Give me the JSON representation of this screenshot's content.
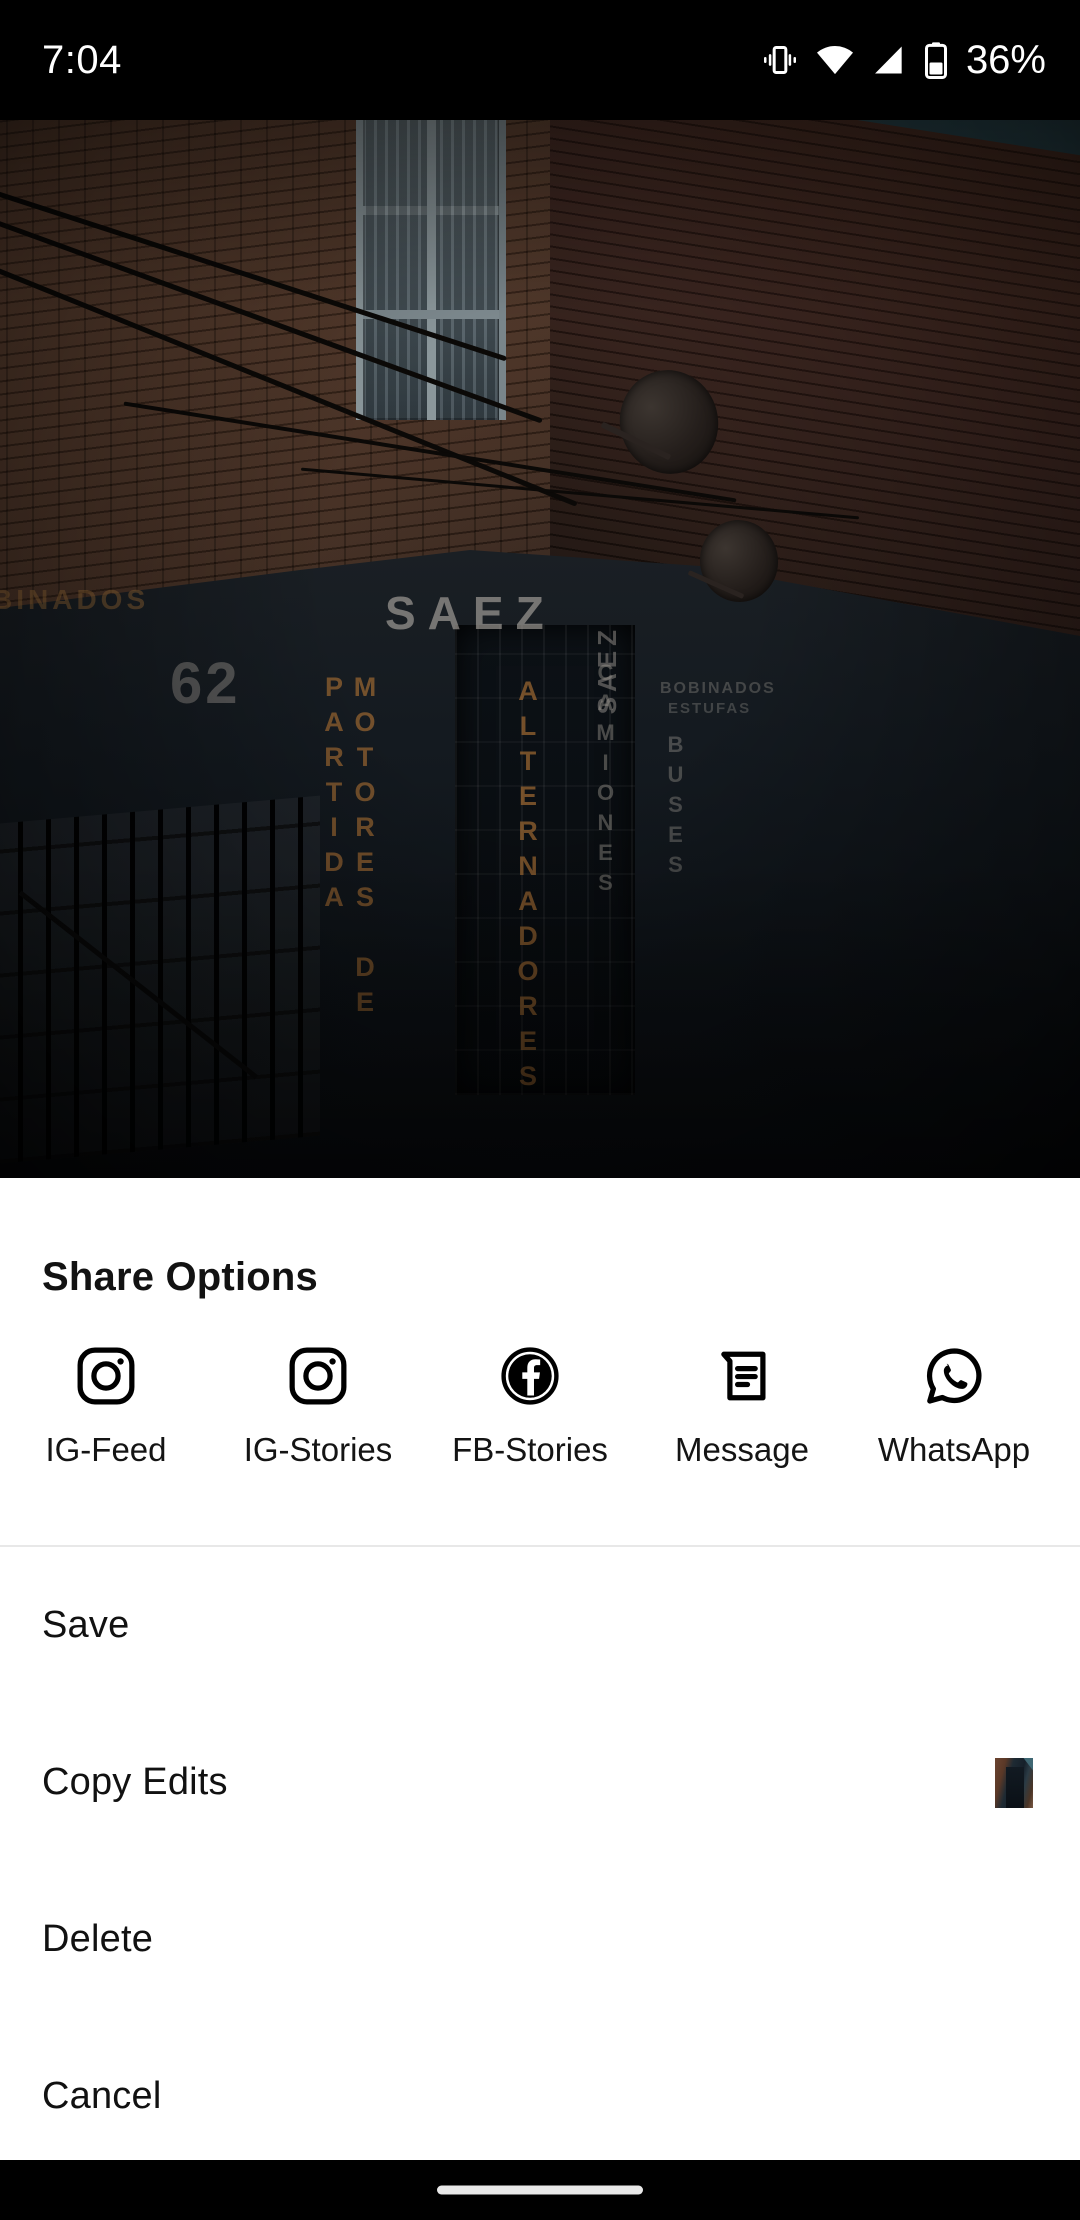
{
  "status_bar": {
    "time": "7:04",
    "battery_percent": "36%",
    "icons": [
      "vibrate-icon",
      "wifi-icon",
      "signal-icon",
      "battery-icon"
    ],
    "background_color": "#000000",
    "text_color": "#ffffff"
  },
  "photo": {
    "description": "dark moody photograph of a corner brick building at dusk",
    "signage": {
      "shop_name": "SAEZ",
      "shop_name_side": "SAEZ",
      "street_number": "62",
      "left_wall": "BINADOS",
      "column_left": "MOTORES DE PARTIDA",
      "column_right": "ALTERNADORES",
      "column_far_left": "CAMIONES",
      "column_far_right": "BUSES",
      "small_sign_1": "BOBINADOS",
      "small_sign_2": "ESTUFAS"
    },
    "sky_color": "#2d4a52",
    "brick_color": "#5c3a28"
  },
  "share_sheet": {
    "title": "Share Options",
    "targets": [
      {
        "label": "IG-Feed",
        "icon": "instagram-icon"
      },
      {
        "label": "IG-Stories",
        "icon": "instagram-icon"
      },
      {
        "label": "FB-Stories",
        "icon": "facebook-icon"
      },
      {
        "label": "Message",
        "icon": "message-icon"
      },
      {
        "label": "WhatsApp",
        "icon": "whatsapp-icon"
      }
    ],
    "menu_items": [
      {
        "label": "Save",
        "has_thumbnail": false
      },
      {
        "label": "Copy Edits",
        "has_thumbnail": true
      },
      {
        "label": "Delete",
        "has_thumbnail": false
      },
      {
        "label": "Cancel",
        "has_thumbnail": false
      }
    ],
    "background_color": "#ffffff",
    "text_color": "#111111",
    "divider_color": "#e8e8e8"
  },
  "nav_bar": {
    "gesture_pill": "home-gesture-pill",
    "background_color": "#000000"
  }
}
